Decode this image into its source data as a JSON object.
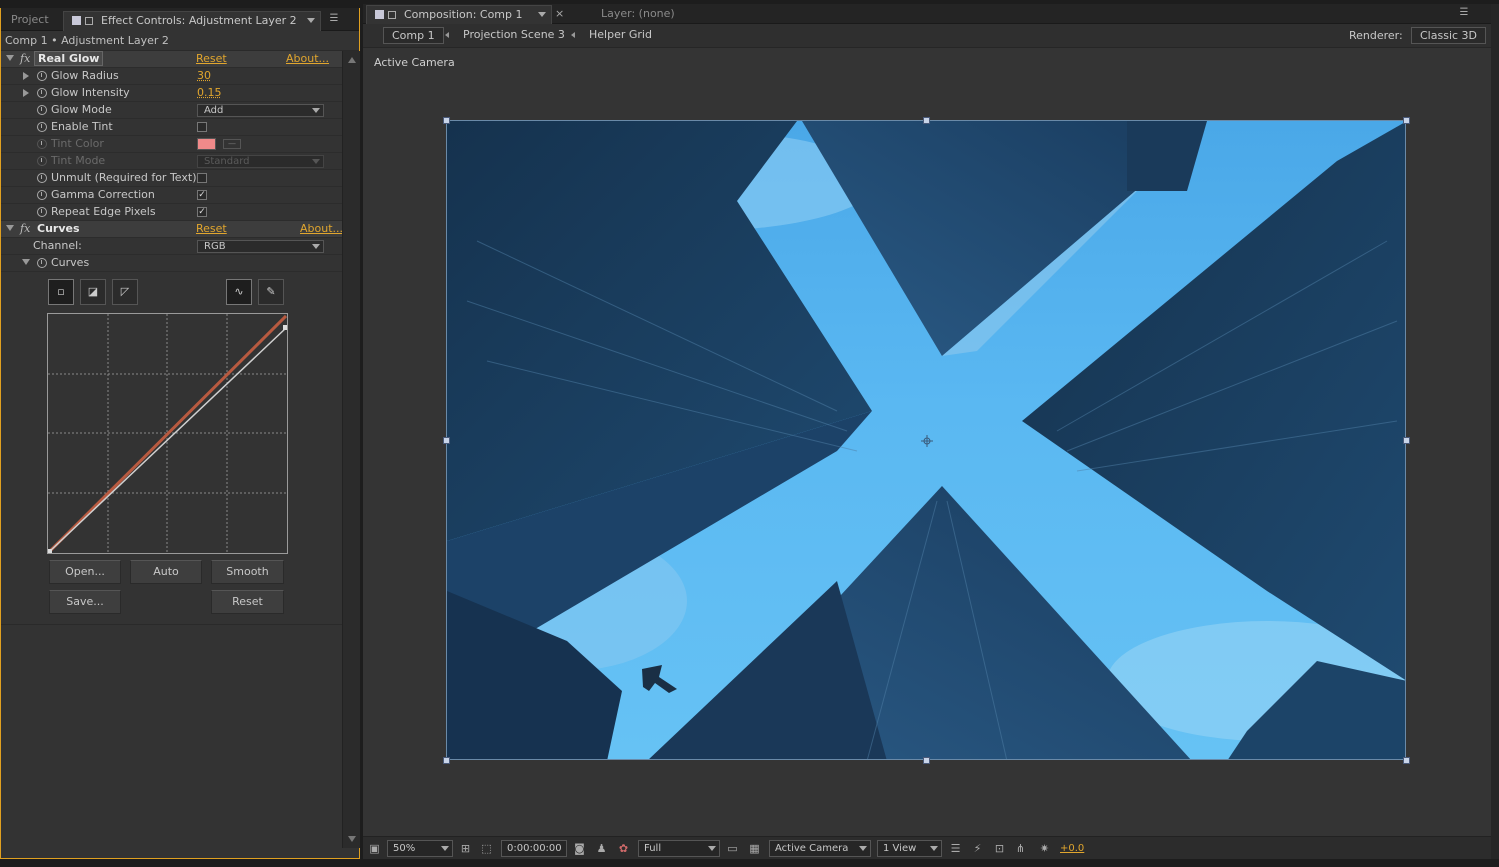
{
  "left_panel": {
    "tabs": {
      "project": "Project",
      "effect_controls": "Effect Controls: Adjustment Layer 2"
    },
    "breadcrumb": "Comp 1 • Adjustment Layer 2",
    "real_glow": {
      "name": "Real Glow",
      "reset": "Reset",
      "about": "About...",
      "properties": {
        "glow_radius": {
          "label": "Glow Radius",
          "value": "30"
        },
        "glow_intensity": {
          "label": "Glow Intensity",
          "value": "0.15"
        },
        "glow_mode": {
          "label": "Glow Mode",
          "value": "Add"
        },
        "enable_tint": {
          "label": "Enable Tint",
          "checked": ""
        },
        "tint_color": {
          "label": "Tint Color",
          "color": "#f08a8a"
        },
        "tint_mode": {
          "label": "Tint Mode",
          "value": "Standard"
        },
        "unmult": {
          "label": "Unmult (Required for Text)",
          "checked": ""
        },
        "gamma_correction": {
          "label": "Gamma Correction",
          "checked": "✓"
        },
        "repeat_edge": {
          "label": "Repeat Edge Pixels",
          "checked": "✓"
        }
      }
    },
    "curves": {
      "name": "Curves",
      "reset": "Reset",
      "about": "About...",
      "channel_label": "Channel:",
      "channel_value": "RGB",
      "curves_label": "Curves",
      "tools": {
        "point": "point-tool-icon",
        "open_curve": "curve-preset-icon",
        "linear": "linear-icon",
        "bezier": "bezier-icon",
        "pencil": "pencil-icon"
      },
      "buttons": {
        "open": "Open...",
        "auto": "Auto",
        "smooth": "Smooth",
        "save": "Save...",
        "reset": "Reset"
      }
    }
  },
  "composition_panel": {
    "tabs": {
      "composition": "Composition: Comp 1",
      "layer": "Layer: (none)"
    },
    "breadcrumbs": [
      "Comp 1",
      "Projection Scene 3",
      "Helper Grid"
    ],
    "renderer_label": "Renderer:",
    "renderer_value": "Classic 3D",
    "viewer_label": "Active Camera",
    "statusbar": {
      "zoom": "50%",
      "timecode": "0:00:00:00",
      "resolution": "Full",
      "camera": "Active Camera",
      "views": "1 View",
      "exposure": "+0.0"
    }
  },
  "colors": {
    "accent_orange": "#e1a62e",
    "panel_bg": "#333333",
    "sky_blue": "#5ab8f2"
  }
}
